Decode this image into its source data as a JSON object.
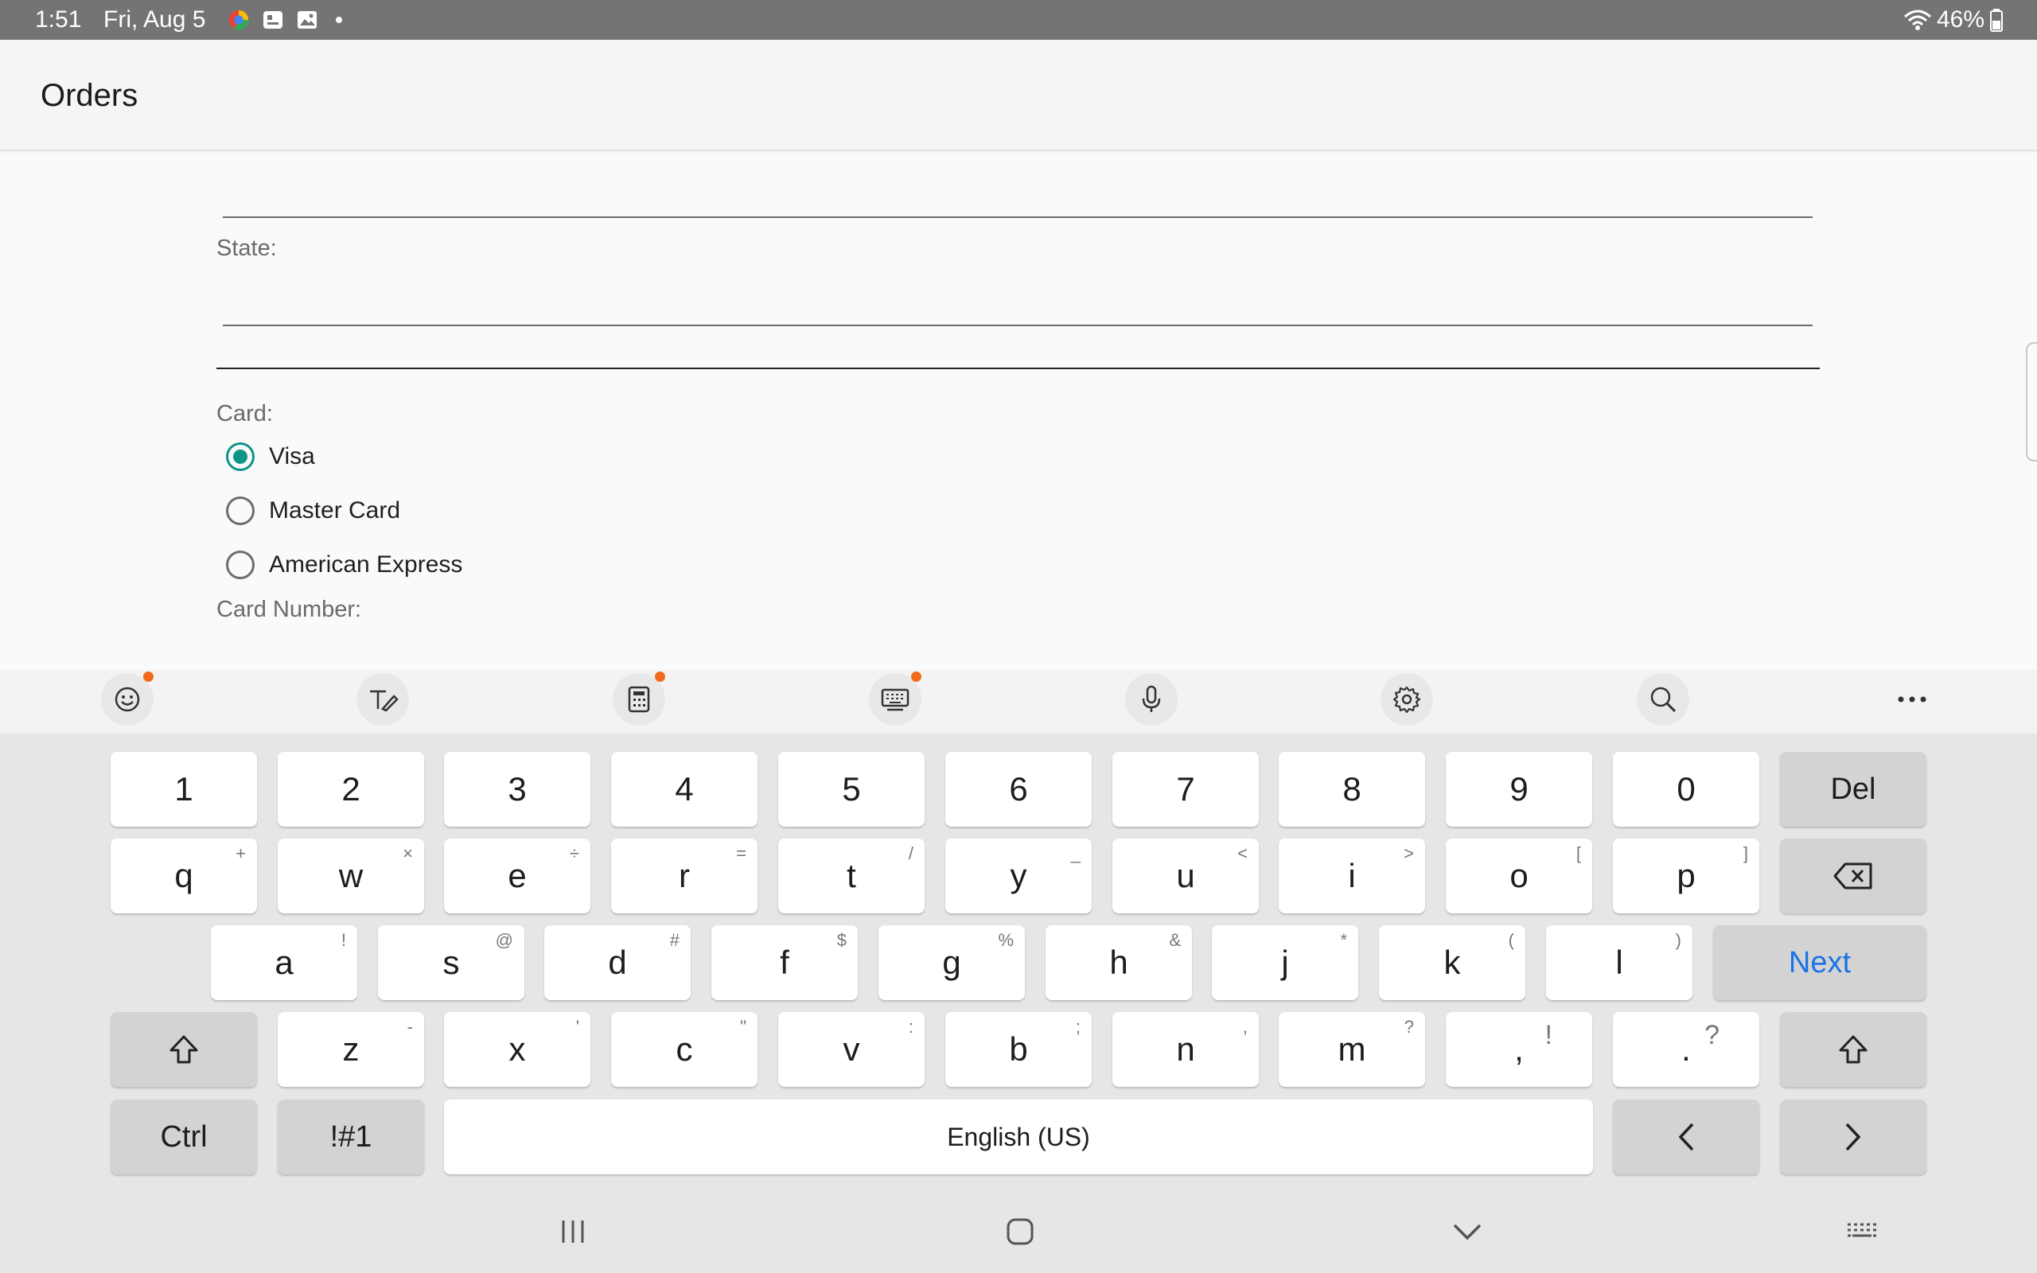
{
  "status_bar": {
    "time": "1:51",
    "date": "Fri, Aug 5",
    "battery": "46%",
    "icons": [
      "browser-icon",
      "notification-icon",
      "gallery-icon",
      "more-dot-icon",
      "wifi-icon",
      "battery-icon"
    ]
  },
  "app_bar": {
    "title": "Orders"
  },
  "form": {
    "state_label": "State:",
    "card_label": "Card:",
    "card_options": [
      {
        "label": "Visa",
        "checked": true
      },
      {
        "label": "Master Card",
        "checked": false
      },
      {
        "label": "American Express",
        "checked": false
      }
    ],
    "card_number_label": "Card Number:"
  },
  "keyboard_toolbar": {
    "icons": [
      "emoji-icon",
      "handwriting-icon",
      "keypad-icon",
      "keyboard-mode-icon",
      "microphone-icon",
      "settings-icon",
      "search-icon",
      "more-icon"
    ]
  },
  "keyboard": {
    "row_numbers": [
      "1",
      "2",
      "3",
      "4",
      "5",
      "6",
      "7",
      "8",
      "9",
      "0"
    ],
    "del_label": "Del",
    "row_q": [
      {
        "k": "q",
        "h": "+"
      },
      {
        "k": "w",
        "h": "×"
      },
      {
        "k": "e",
        "h": "÷"
      },
      {
        "k": "r",
        "h": "="
      },
      {
        "k": "t",
        "h": "/"
      },
      {
        "k": "y",
        "h": "_"
      },
      {
        "k": "u",
        "h": "<"
      },
      {
        "k": "i",
        "h": ">"
      },
      {
        "k": "o",
        "h": "["
      },
      {
        "k": "p",
        "h": "]"
      }
    ],
    "row_a": [
      {
        "k": "a",
        "h": "!"
      },
      {
        "k": "s",
        "h": "@"
      },
      {
        "k": "d",
        "h": "#"
      },
      {
        "k": "f",
        "h": "$"
      },
      {
        "k": "g",
        "h": "%"
      },
      {
        "k": "h",
        "h": "&"
      },
      {
        "k": "j",
        "h": "*"
      },
      {
        "k": "k",
        "h": "("
      },
      {
        "k": "l",
        "h": ")"
      }
    ],
    "next_label": "Next",
    "row_z": [
      {
        "k": "z",
        "h": "-"
      },
      {
        "k": "x",
        "h": "'"
      },
      {
        "k": "c",
        "h": "\""
      },
      {
        "k": "v",
        "h": ":"
      },
      {
        "k": "b",
        "h": ";"
      },
      {
        "k": "n",
        "h": ","
      },
      {
        "k": "m",
        "h": "?"
      },
      {
        "k": ",",
        "h": "!"
      },
      {
        "k": ".",
        "h": "?"
      }
    ],
    "ctrl_label": "Ctrl",
    "symbols_label": "!#1",
    "space_label": "English (US)"
  },
  "nav_bar": {
    "icons": [
      "recent-apps-icon",
      "home-icon",
      "back-icon",
      "keyboard-hide-icon"
    ]
  }
}
